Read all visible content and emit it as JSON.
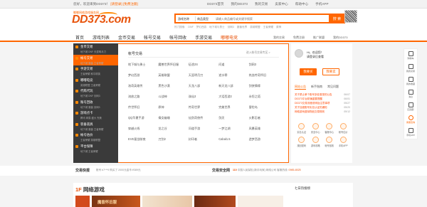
{
  "topbar": {
    "welcome": "您好，欢迎来到DD373！",
    "login": "[请登录]",
    "register": "[免费注册]",
    "links": [
      "DD373首页",
      "我的DD373",
      "我的交易",
      "卖家中心",
      "帮助中心",
      "手机APP"
    ]
  },
  "logo": {
    "main": "DD373.com",
    "sub": "嘟嘟网络游戏服务网"
  },
  "search": {
    "game_select": "游戏名称",
    "type_select": "商品类型",
    "placeholder": "请输入商品编号或关键字搜索",
    "button": "搜 索",
    "hot_words": [
      "热门搜索:",
      "DNF",
      "梦幻西游",
      "地下城与勇士",
      "剑网3",
      "魔兽世界",
      "英雄联盟",
      "王者荣耀",
      "原神"
    ]
  },
  "nav": {
    "items": [
      "首页",
      "游戏列表",
      "金币交易",
      "帐号交易",
      "帐号回收",
      "手游交易",
      "嘟嘟电竞"
    ],
    "right": [
      "我的交易",
      "免费注册",
      "推广联盟",
      "我的DD373"
    ]
  },
  "side_menu": [
    {
      "title": "金币交易",
      "sub": "地下城 DNF 天涯明月刀",
      "active": false
    },
    {
      "title": "帐号交易",
      "sub": "地下城 魔兽 王者荣耀",
      "active": true
    },
    {
      "title": "手游交易",
      "sub": "王者荣耀 和平精英",
      "active": false
    },
    {
      "title": "嘟嘟电竞",
      "sub": "英雄联盟 王者荣耀",
      "active": false
    },
    {
      "title": "代练代玩",
      "sub": "地下城 DNF 剑网3",
      "active": false
    },
    {
      "title": "账号回收",
      "sub": "地下城 魔兽 剑网3",
      "active": false
    },
    {
      "title": "游戏点卡",
      "sub": "腾讯 网易 盛大 完美",
      "active": false
    },
    {
      "title": "装备道具",
      "sub": "地下城 魔兽 王者荣耀",
      "active": false
    },
    {
      "title": "帐号估价",
      "sub": "王者荣耀 英雄联盟",
      "active": false
    },
    {
      "title": "平台保障",
      "sub": "地下城 王者荣耀",
      "active": false
    }
  ],
  "panel": {
    "title": "帐号交易",
    "note": "进入帐号交易专区 >",
    "games": [
      "地下城与勇士",
      "魔兽世界怀旧服",
      "征途2S",
      "问道",
      "剑网3",
      "梦幻西游",
      "英雄联盟",
      "天涯明月刀",
      "逆水寒",
      "热血传奇怀旧",
      "洛奇英雄传",
      "黑色沙漠",
      "天龙八部",
      "新天龙八部",
      "剑侠情缘",
      "流放之路",
      "斗战神",
      "诛仙3",
      "大话西游2",
      "永恒之塔",
      "传世怀旧",
      "原神",
      "传奇世界",
      "完美世界",
      "冒险岛",
      "QQ华夏手游",
      "倩女幽魂",
      "仙剑奇侠传",
      "剑灵",
      "火影忍者",
      "穿越火线",
      "龙之谷",
      "问道手游",
      "一梦江湖",
      "风暴英雄",
      "EVE星战前夜",
      "刀剑2",
      "封印者",
      "Cabal1.5",
      "造梦西游"
    ]
  },
  "user": {
    "greeting": "Hi，欢迎您！",
    "sub": "请登录后查看",
    "buy_button": "我要买",
    "sell_button": "我要卖",
    "tabs": [
      "网站公告",
      "新手指南",
      "常见问题"
    ],
    "news": [
      {
        "text": "关于禁止单个账号多处登录的公告",
        "num": "06/07"
      },
      {
        "text": "DD373平台防骗重要提醒",
        "num": "06/01"
      },
      {
        "text": "DD373交易流程说明及注意事项",
        "num": "05/27"
      },
      {
        "text": "关于加强账号实名认证的通知",
        "num": "05/20"
      },
      {
        "text": "网络游戏虚拟物品交易规则",
        "num": "05/12"
      }
    ],
    "services": [
      "实名认证",
      "安全中心",
      "客服中心",
      "帐号估价",
      "找回密码",
      "游戏攻略",
      "帐号回收",
      "手机APP"
    ]
  },
  "rightbar": [
    "购物车",
    "我的交易",
    "我的收藏",
    "消息",
    "回顶部",
    "客服咨询",
    "手机APP"
  ],
  "ticker": {
    "left_title": "交易快报",
    "left_text": "账号 b7***9 购买了 2000元金币 ¥389元",
    "mid_title": "交易安全网",
    "mid_badge": "110",
    "mid_text": "中国人民保险 [新手玩家] 网络公司 客服热线:",
    "phone": "0985-8025"
  },
  "section": {
    "number": "1F",
    "title": "网络游戏",
    "more": "更多网络游戏 >",
    "banner_text": "魔兽怀旧服",
    "right_title": "七日热搜榜",
    "right_prefix": "七"
  }
}
